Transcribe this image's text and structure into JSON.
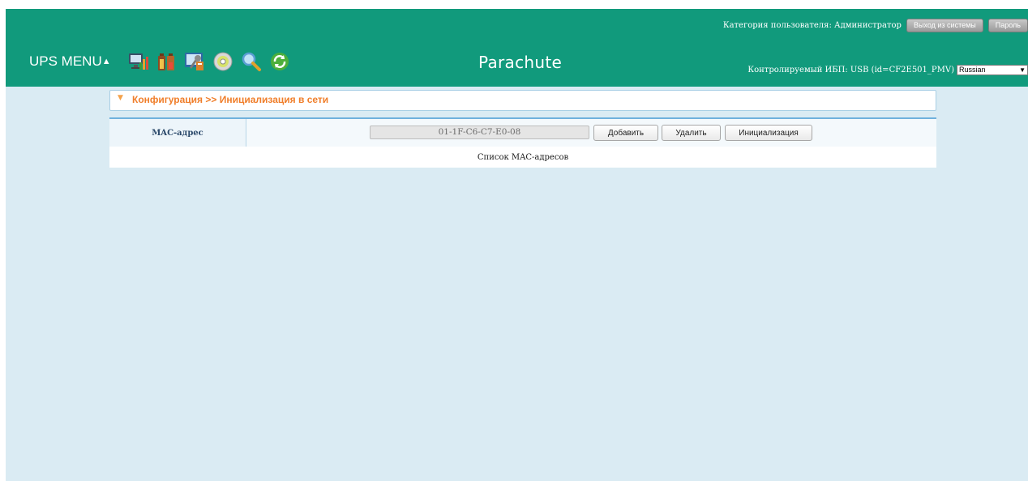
{
  "header": {
    "user_category": "Категория пользователя: Администратор",
    "logout_label": "Выход из системы",
    "password_label": "Пароль",
    "ups_menu": "UPS MENU",
    "ups_menu_arrow": "▲",
    "brand": "Parachute",
    "monitored_ups": "Контролируемый ИБП: USB (id=CF2E501_PMV)",
    "language": "Russian",
    "icons": [
      "monitor-chart-icon",
      "battery-icon",
      "settings-tools-icon",
      "disc-icon",
      "search-icon",
      "refresh-icon"
    ]
  },
  "breadcrumb": {
    "text": "Конфигурация >> Инициализация в сети"
  },
  "form": {
    "mac_label": "MAC-адрес",
    "mac_value": "01-1F-C6-C7-E0-08",
    "add_label": "Добавить",
    "delete_label": "Удалить",
    "init_label": "Инициализация",
    "list_label": "Список MAC-адресов"
  },
  "colors": {
    "header_bg": "#119a7c",
    "content_bg": "#daebf3",
    "accent_orange": "#f07e2a",
    "panel_border": "#6fb1dd"
  }
}
